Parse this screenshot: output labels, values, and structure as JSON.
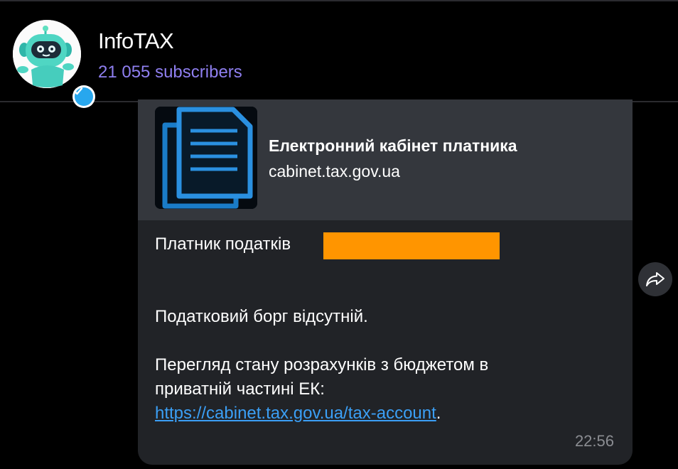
{
  "header": {
    "title": "InfoTAX",
    "subscribers": "21 055 subscribers"
  },
  "link_preview": {
    "title": "Електронний кабінет платника",
    "domain": "cabinet.tax.gov.ua",
    "thumbnail_icon": "document-icon"
  },
  "message": {
    "line1_prefix": "Платник податків",
    "line2": "Податковий борг відсутній.",
    "line3": "Перегляд стану розрахунків з бюджетом в",
    "line4": "приватній частині ЕК:",
    "link": "https://cabinet.tax.gov.ua/tax-account",
    "link_suffix": ".",
    "time": "22:56"
  },
  "colors": {
    "background": "#000000",
    "bubble": "#212327",
    "preview": "#34373d",
    "subscribers": "#8f7ff0",
    "link": "#3b9ff5",
    "redaction": "#ff9500",
    "verified": "#28a7ee"
  },
  "icons": {
    "forward": "share-arrow-icon",
    "verified": "verified-check-icon",
    "avatar": "robot-avatar"
  }
}
